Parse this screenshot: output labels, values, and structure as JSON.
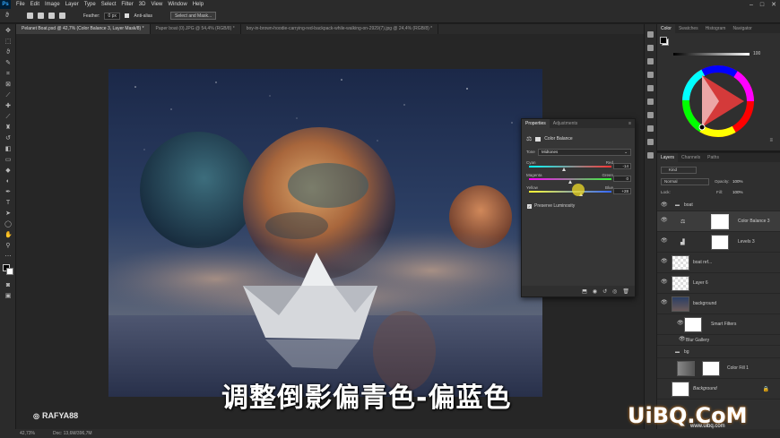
{
  "menubar": {
    "app_icon": "Ps",
    "items": [
      "File",
      "Edit",
      "Image",
      "Layer",
      "Type",
      "Select",
      "Filter",
      "3D",
      "View",
      "Window",
      "Help"
    ],
    "window_controls": [
      "–",
      "□",
      "✕"
    ]
  },
  "options": {
    "feather_label": "Feather:",
    "feather_value": "0 px",
    "antialias_label": "Anti-alias",
    "select_mask_label": "Select and Mask..."
  },
  "tabs": [
    {
      "label": "Pelanet Boat.psd @ 42,7% (Color Balance 3, Layer Mask/8) *",
      "active": true
    },
    {
      "label": "Paper boat (0).JPG @ 54,4% (RGB/8) *",
      "active": false
    },
    {
      "label": "boy-in-brown-hoodie-carrying-red-backpack-while-walking-on-2929(7).jpg @ 24,4% (RGB/8) *",
      "active": false
    }
  ],
  "properties": {
    "tabs": [
      "Properties",
      "Adjustments"
    ],
    "title": "Color Balance",
    "tone_label": "Tone",
    "tone_value": "Midtones",
    "sliders": [
      {
        "left": "Cyan",
        "right": "Red",
        "value": "-14",
        "fraction": 0.43
      },
      {
        "left": "Magenta",
        "right": "Green",
        "value": "0",
        "fraction": 0.5
      },
      {
        "left": "Yellow",
        "right": "Blue",
        "value": "+28",
        "fraction": 0.64
      }
    ],
    "preserve_label": "Preserve Luminosity"
  },
  "color_panel": {
    "tabs": [
      "Color",
      "Swatches",
      "Histogram",
      "Navigator"
    ],
    "value": "100"
  },
  "layers_panel": {
    "tabs": [
      "Layers",
      "Channels",
      "Paths"
    ],
    "kind": "Kind",
    "blend": "Normal",
    "opacity_label": "Opacity:",
    "opacity": "100%",
    "lock_label": "Lock:",
    "fill_label": "Fill:",
    "fill": "100%",
    "layers": [
      {
        "name": "boat",
        "type": "group"
      },
      {
        "name": "Color Balance 3",
        "type": "adjustment",
        "selected": true
      },
      {
        "name": "Levels 3",
        "type": "adjustment"
      },
      {
        "name": "boat ref...",
        "type": "pixel"
      },
      {
        "name": "Layer 6",
        "type": "pixel"
      },
      {
        "name": "background",
        "type": "smart"
      },
      {
        "name": "Smart Filters",
        "type": "filter"
      },
      {
        "name": "Blur Gallery",
        "type": "filter-item"
      },
      {
        "name": "bg",
        "type": "group"
      },
      {
        "name": "Color Fill 1",
        "type": "fill"
      },
      {
        "name": "Background",
        "type": "background"
      }
    ]
  },
  "status": {
    "zoom": "42,73%",
    "doc": "Doc: 13,6M/396,7M"
  },
  "subtitle": "调整倒影偏青色-偏蓝色",
  "watermark": "RAFYA88",
  "logo": "UiBQ.CoM",
  "logo_sub": "www.uibq.com",
  "colors": {
    "ps_blue": "#31a8ff",
    "panel_bg": "#2f2f2f",
    "canvas_bg": "#262626"
  }
}
